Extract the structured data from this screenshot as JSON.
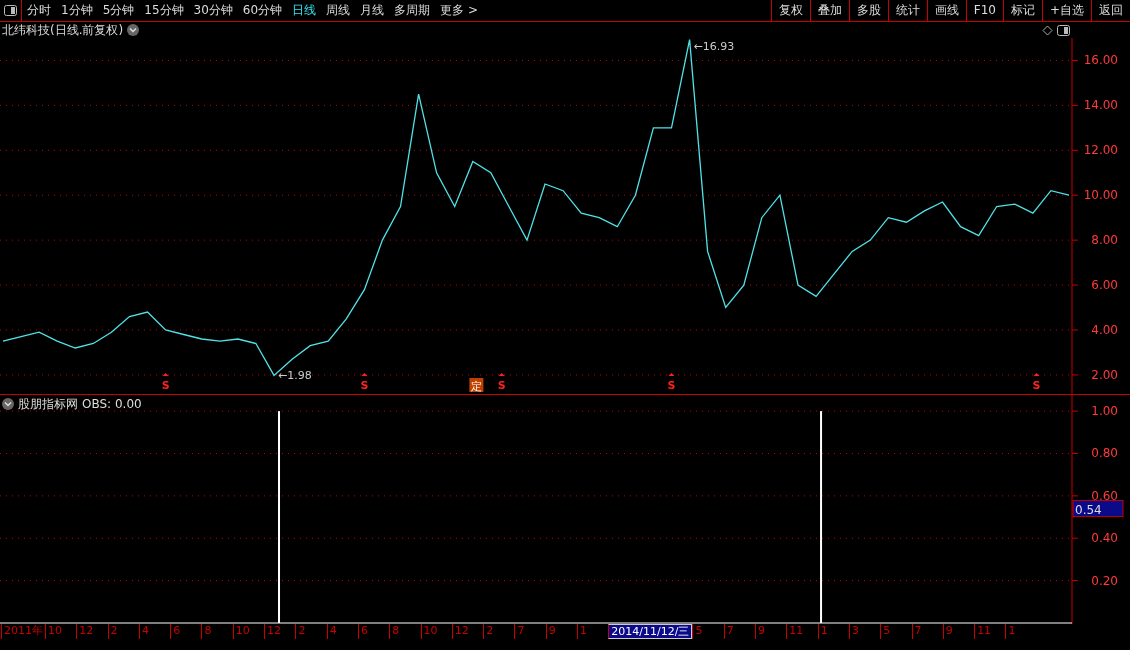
{
  "toolbar": {
    "tabs": [
      {
        "label": "分时",
        "selected": false
      },
      {
        "label": "1分钟",
        "selected": false
      },
      {
        "label": "5分钟",
        "selected": false
      },
      {
        "label": "15分钟",
        "selected": false
      },
      {
        "label": "30分钟",
        "selected": false
      },
      {
        "label": "60分钟",
        "selected": false
      },
      {
        "label": "日线",
        "selected": true
      },
      {
        "label": "周线",
        "selected": false
      },
      {
        "label": "月线",
        "selected": false
      },
      {
        "label": "多周期",
        "selected": false
      },
      {
        "label": "更多 >",
        "selected": false
      }
    ],
    "buttons": [
      "复权",
      "叠加",
      "多股",
      "统计",
      "画线",
      "F10",
      "标记",
      "+自选",
      "返回"
    ]
  },
  "main_chart": {
    "title": "北纬科技(日线.前复权)",
    "chart_data": {
      "type": "line",
      "grid": true,
      "ylim": [
        1.15,
        17.0
      ],
      "yticks": [
        {
          "value": 2,
          "label": "2.00"
        },
        {
          "value": 4,
          "label": "4.00"
        },
        {
          "value": 6,
          "label": "6.00"
        },
        {
          "value": 8,
          "label": "8.00"
        },
        {
          "value": 10,
          "label": "10.00"
        },
        {
          "value": 12,
          "label": "12.00"
        },
        {
          "value": 14,
          "label": "14.00"
        },
        {
          "value": 16,
          "label": "16.00"
        }
      ],
      "series": [
        {
          "color": "#4fe3e8",
          "values": [
            3.5,
            3.7,
            3.9,
            3.5,
            3.2,
            3.4,
            3.9,
            4.6,
            4.8,
            4.0,
            3.8,
            3.6,
            3.5,
            3.6,
            3.4,
            1.98,
            2.7,
            3.3,
            3.5,
            4.5,
            5.8,
            8.0,
            9.5,
            14.5,
            11.0,
            9.5,
            11.5,
            11.0,
            9.5,
            8.0,
            10.5,
            10.2,
            9.2,
            9.0,
            8.6,
            10.0,
            13.0,
            13.0,
            16.93,
            7.5,
            5.0,
            6.0,
            9.0,
            10.0,
            6.0,
            5.5,
            6.5,
            7.5,
            8.0,
            9.0,
            8.8,
            9.3,
            9.7,
            8.6,
            8.2,
            9.5,
            9.6,
            9.2,
            10.2,
            10.0
          ]
        }
      ],
      "annotations": [
        "←16.93",
        "←1.98"
      ]
    },
    "markers": [
      {
        "kind": "signal",
        "label": "S"
      },
      {
        "kind": "signal",
        "label": "S"
      },
      {
        "kind": "tag",
        "label": "定"
      },
      {
        "kind": "signal",
        "label": "S"
      },
      {
        "kind": "signal",
        "label": "S"
      },
      {
        "kind": "signal",
        "label": "S"
      }
    ]
  },
  "indicator": {
    "title": "股朋指标网",
    "reading": "OBS: 0.00",
    "cursor_value": "0.54",
    "chart_data": {
      "type": "bar",
      "grid": true,
      "ylim": [
        0,
        1.076
      ],
      "yticks": [
        {
          "value": 0.2,
          "label": "0.20"
        },
        {
          "value": 0.4,
          "label": "0.40"
        },
        {
          "value": 0.6,
          "label": "0.60"
        },
        {
          "value": 0.8,
          "label": "0.80"
        },
        {
          "value": 1.0,
          "label": "1.00"
        }
      ],
      "series": [
        {
          "color": "#ffffff",
          "values": [
            0,
            0,
            0,
            0,
            0,
            0,
            0,
            0,
            0,
            0,
            0,
            0,
            0,
            0,
            0,
            1,
            0,
            0,
            0,
            0,
            0,
            0,
            0,
            0,
            0,
            0,
            0,
            0,
            0,
            0,
            0,
            0,
            0,
            0,
            0,
            0,
            0,
            0,
            0,
            0,
            0,
            0,
            0,
            0,
            0,
            1,
            0,
            0,
            0,
            0,
            0,
            0,
            0,
            0,
            0,
            0,
            0,
            0,
            0,
            0
          ]
        }
      ]
    }
  },
  "time_axis": [
    {
      "label": "2011年",
      "selected": false
    },
    {
      "label": "10",
      "selected": false
    },
    {
      "label": "12",
      "selected": false
    },
    {
      "label": "2",
      "selected": false
    },
    {
      "label": "4",
      "selected": false
    },
    {
      "label": "6",
      "selected": false
    },
    {
      "label": "8",
      "selected": false
    },
    {
      "label": "10",
      "selected": false
    },
    {
      "label": "12",
      "selected": false
    },
    {
      "label": "2",
      "selected": false
    },
    {
      "label": "4",
      "selected": false
    },
    {
      "label": "6",
      "selected": false
    },
    {
      "label": "8",
      "selected": false
    },
    {
      "label": "10",
      "selected": false
    },
    {
      "label": "12",
      "selected": false
    },
    {
      "label": "2",
      "selected": false
    },
    {
      "label": "7",
      "selected": false
    },
    {
      "label": "9",
      "selected": false
    },
    {
      "label": "1",
      "selected": false
    },
    {
      "label": "2014/11/12/三",
      "selected": true
    },
    {
      "label": "5",
      "selected": false
    },
    {
      "label": "7",
      "selected": false
    },
    {
      "label": "9",
      "selected": false
    },
    {
      "label": "11",
      "selected": false
    },
    {
      "label": "1",
      "selected": false
    },
    {
      "label": "3",
      "selected": false
    },
    {
      "label": "5",
      "selected": false
    },
    {
      "label": "7",
      "selected": false
    },
    {
      "label": "9",
      "selected": false
    },
    {
      "label": "11",
      "selected": false
    },
    {
      "label": "1",
      "selected": false
    }
  ]
}
